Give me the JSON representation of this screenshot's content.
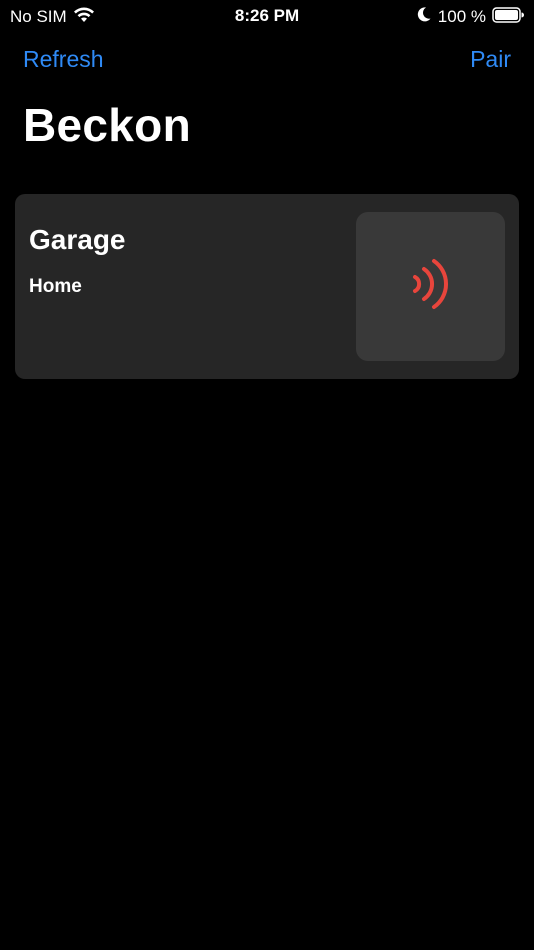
{
  "status_bar": {
    "carrier": "No SIM",
    "time": "8:26 PM",
    "battery_percent": "100 %",
    "battery_level": 1.0
  },
  "nav": {
    "left_label": "Refresh",
    "right_label": "Pair"
  },
  "title": "Beckon",
  "devices": [
    {
      "name": "Garage",
      "location": "Home",
      "icon": "signal-waves-icon",
      "icon_color": "#e8453c"
    }
  ],
  "colors": {
    "accent": "#2f8af5",
    "card_bg": "#262626",
    "button_bg": "#393939",
    "signal": "#e8453c"
  }
}
